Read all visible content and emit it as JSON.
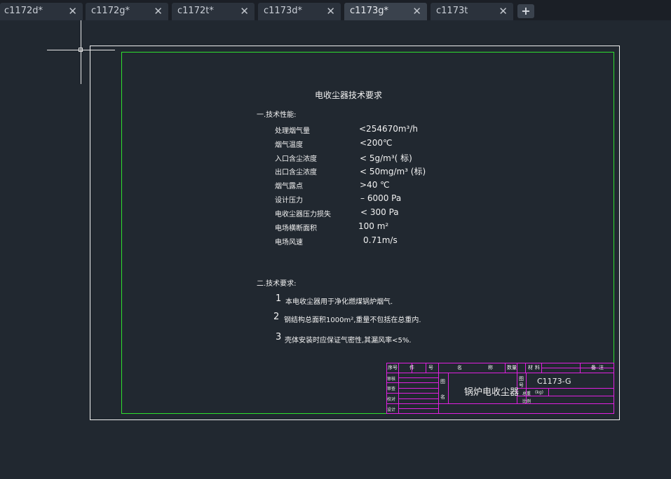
{
  "tabs": [
    {
      "label": "c1172d*",
      "active": false
    },
    {
      "label": "c1172g*",
      "active": false
    },
    {
      "label": "c1172t*",
      "active": false
    },
    {
      "label": "c1173d*",
      "active": false
    },
    {
      "label": "c1173g*",
      "active": true
    },
    {
      "label": "c1173t",
      "active": false
    }
  ],
  "close_glyph": "✕",
  "new_tab_glyph": "+",
  "drawing": {
    "title": "电收尘器技术要求",
    "section1": "一.技术性能:",
    "specs": [
      {
        "label": "处理烟气量",
        "value": "<254670m³/h"
      },
      {
        "label": "烟气温度",
        "value": "<200℃"
      },
      {
        "label": "入口含尘浓度",
        "value": "< 5g/m³( 标)"
      },
      {
        "label": "出口含尘浓度",
        "value": "< 50mg/m³ (标)"
      },
      {
        "label": "烟气露点",
        "value": ">40 ℃"
      },
      {
        "label": "设计压力",
        "value": "– 6000 Pa"
      },
      {
        "label": "电收尘器压力损失",
        "value": "< 300 Pa"
      },
      {
        "label": "电场横断面积",
        "value": "100 m²"
      },
      {
        "label": "电场风速",
        "value": "0.71m/s"
      }
    ],
    "section2": "二.技术要求:",
    "requirements": [
      {
        "num": "1",
        "text": "本电收尘器用于净化燃煤锅炉烟气."
      },
      {
        "num": "2",
        "text": "钢结构总面积1000m²,重量不包括在总重内."
      },
      {
        "num": "3",
        "text": "壳体安装时应保证气密性,其漏风率<5%."
      }
    ]
  },
  "title_block": {
    "product_name": "锅炉电收尘器",
    "drawing_number": "C1173-G",
    "headers": [
      "序号",
      "件",
      "号",
      "名",
      "称",
      "数量",
      "材",
      "料",
      "备",
      "注"
    ],
    "rows": [
      "审核",
      "审查",
      "校对",
      "设计"
    ],
    "marks": [
      "图",
      "名",
      "图",
      "号",
      "总重",
      "比例",
      "(kg)"
    ]
  },
  "colors": {
    "background": "#212830",
    "inner_frame": "#2ee02e",
    "title_block": "#e020e0"
  }
}
